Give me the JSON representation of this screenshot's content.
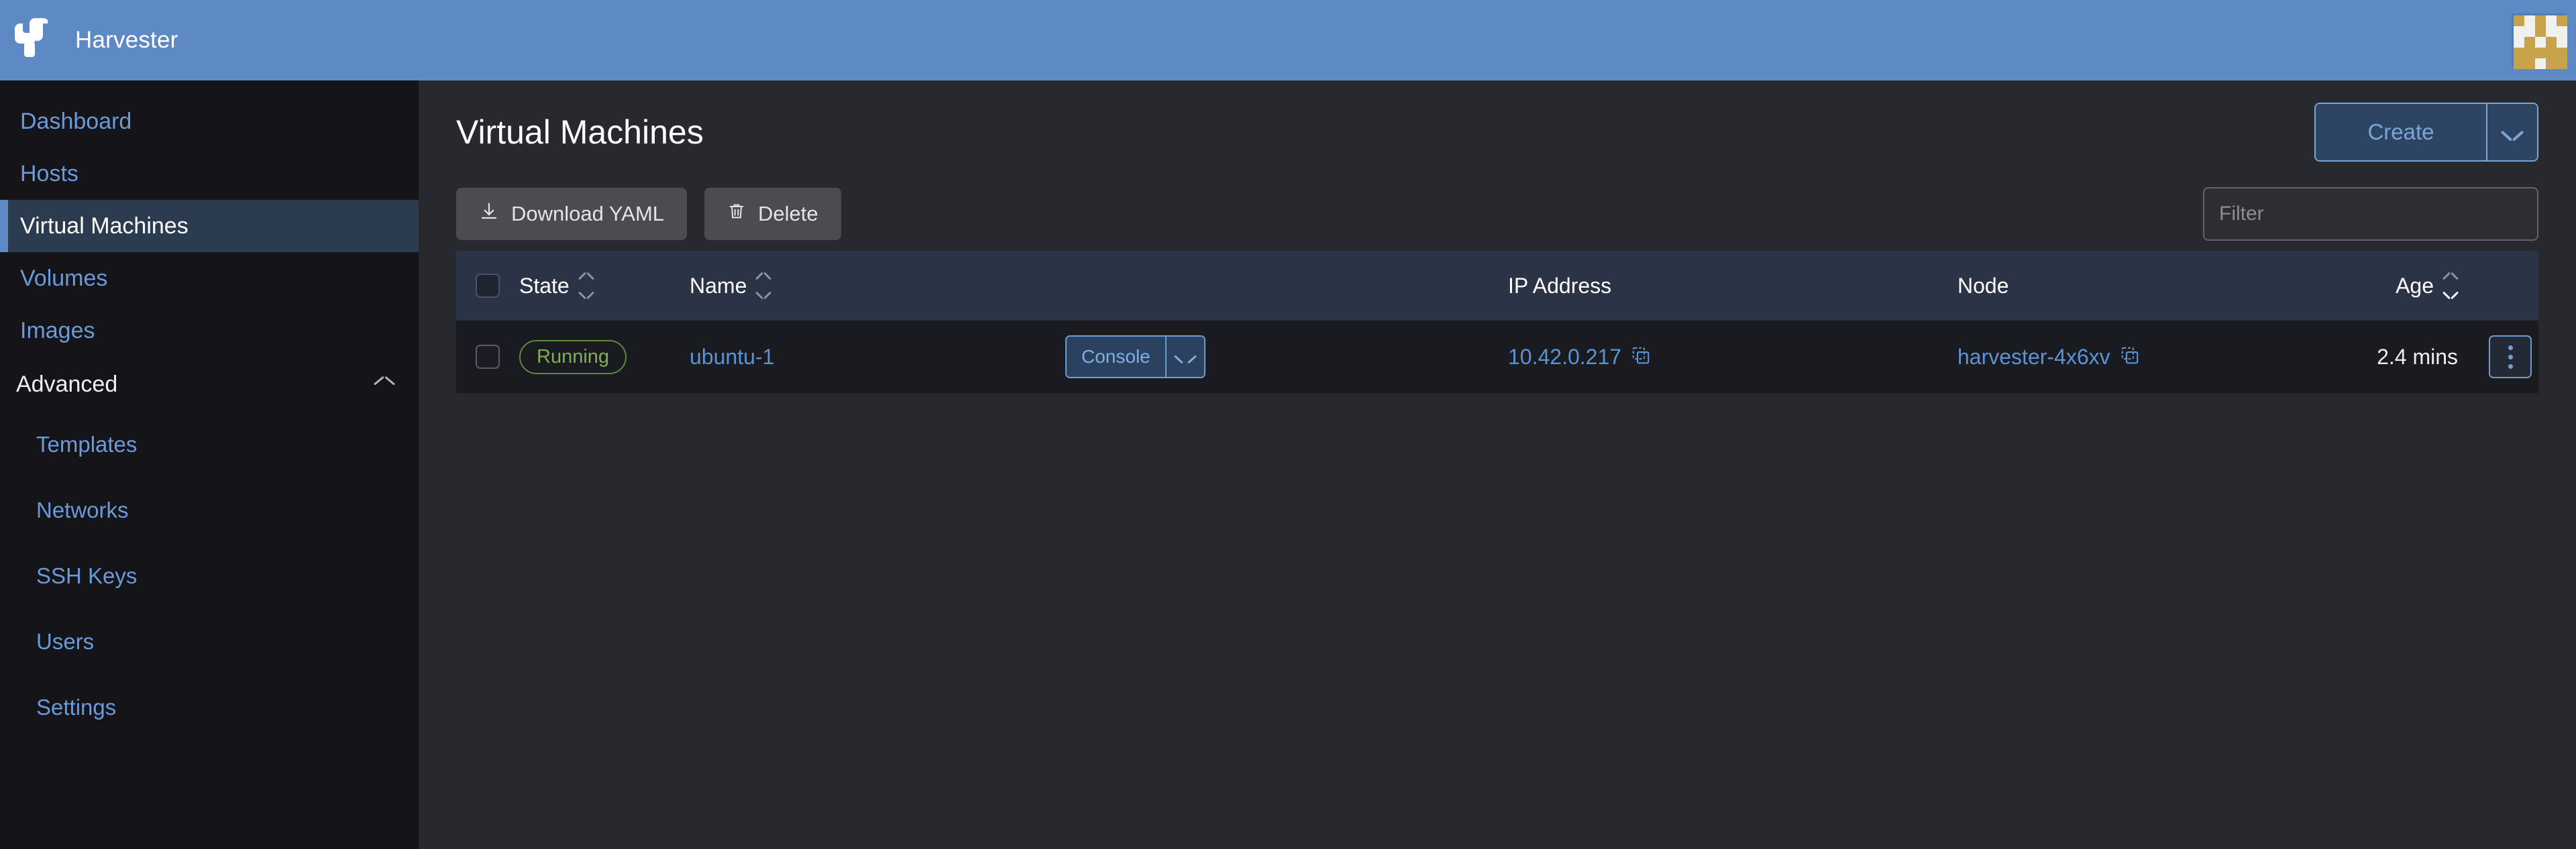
{
  "brand": {
    "name": "Harvester",
    "logo_icon": "harvester-logo-icon",
    "header_color": "#5d8ac4"
  },
  "topbar": {
    "avatar_icon": "user-identicon-avatar",
    "avatar_colors": [
      "#c9a24c",
      "#f0f0f0"
    ]
  },
  "sidebar": {
    "items": [
      {
        "label": "Dashboard",
        "active": false
      },
      {
        "label": "Hosts",
        "active": false
      },
      {
        "label": "Virtual Machines",
        "active": true
      },
      {
        "label": "Volumes",
        "active": false
      },
      {
        "label": "Images",
        "active": false
      }
    ],
    "group": {
      "label": "Advanced",
      "expanded": true,
      "chevron_icon": "chevron-up-icon",
      "items": [
        {
          "label": "Templates"
        },
        {
          "label": "Networks"
        },
        {
          "label": "SSH Keys"
        },
        {
          "label": "Users"
        },
        {
          "label": "Settings"
        }
      ]
    },
    "active_accent": "#5d8ac4",
    "link_color": "#6a9ada"
  },
  "page": {
    "title": "Virtual Machines",
    "create": {
      "label": "Create",
      "chevron_icon": "chevron-down-icon"
    }
  },
  "toolbar": {
    "download_yaml": {
      "label": "Download YAML",
      "icon": "download-icon"
    },
    "delete": {
      "label": "Delete",
      "icon": "trash-icon"
    },
    "filter": {
      "value": "",
      "placeholder": "Filter"
    }
  },
  "table": {
    "columns": [
      {
        "key": "select",
        "label": "",
        "sortable": false
      },
      {
        "key": "state",
        "label": "State",
        "sortable": true,
        "sort": "none"
      },
      {
        "key": "name",
        "label": "Name",
        "sortable": true,
        "sort": "none"
      },
      {
        "key": "console",
        "label": "",
        "sortable": false
      },
      {
        "key": "ip",
        "label": "IP Address",
        "sortable": false
      },
      {
        "key": "node",
        "label": "Node",
        "sortable": false
      },
      {
        "key": "age",
        "label": "Age",
        "sortable": true,
        "sort": "desc"
      }
    ],
    "rows": [
      {
        "selected": false,
        "state": "Running",
        "state_color": "#7fb04f",
        "name": "ubuntu-1",
        "console": {
          "label": "Console",
          "chevron_icon": "chevron-down-icon"
        },
        "ip": "10.42.0.217",
        "ip_copy_icon": "copy-icon",
        "node": "harvester-4x6xv",
        "node_copy_icon": "copy-icon",
        "age": "2.4 mins",
        "actions_icon": "kebab-menu-icon"
      }
    ]
  }
}
